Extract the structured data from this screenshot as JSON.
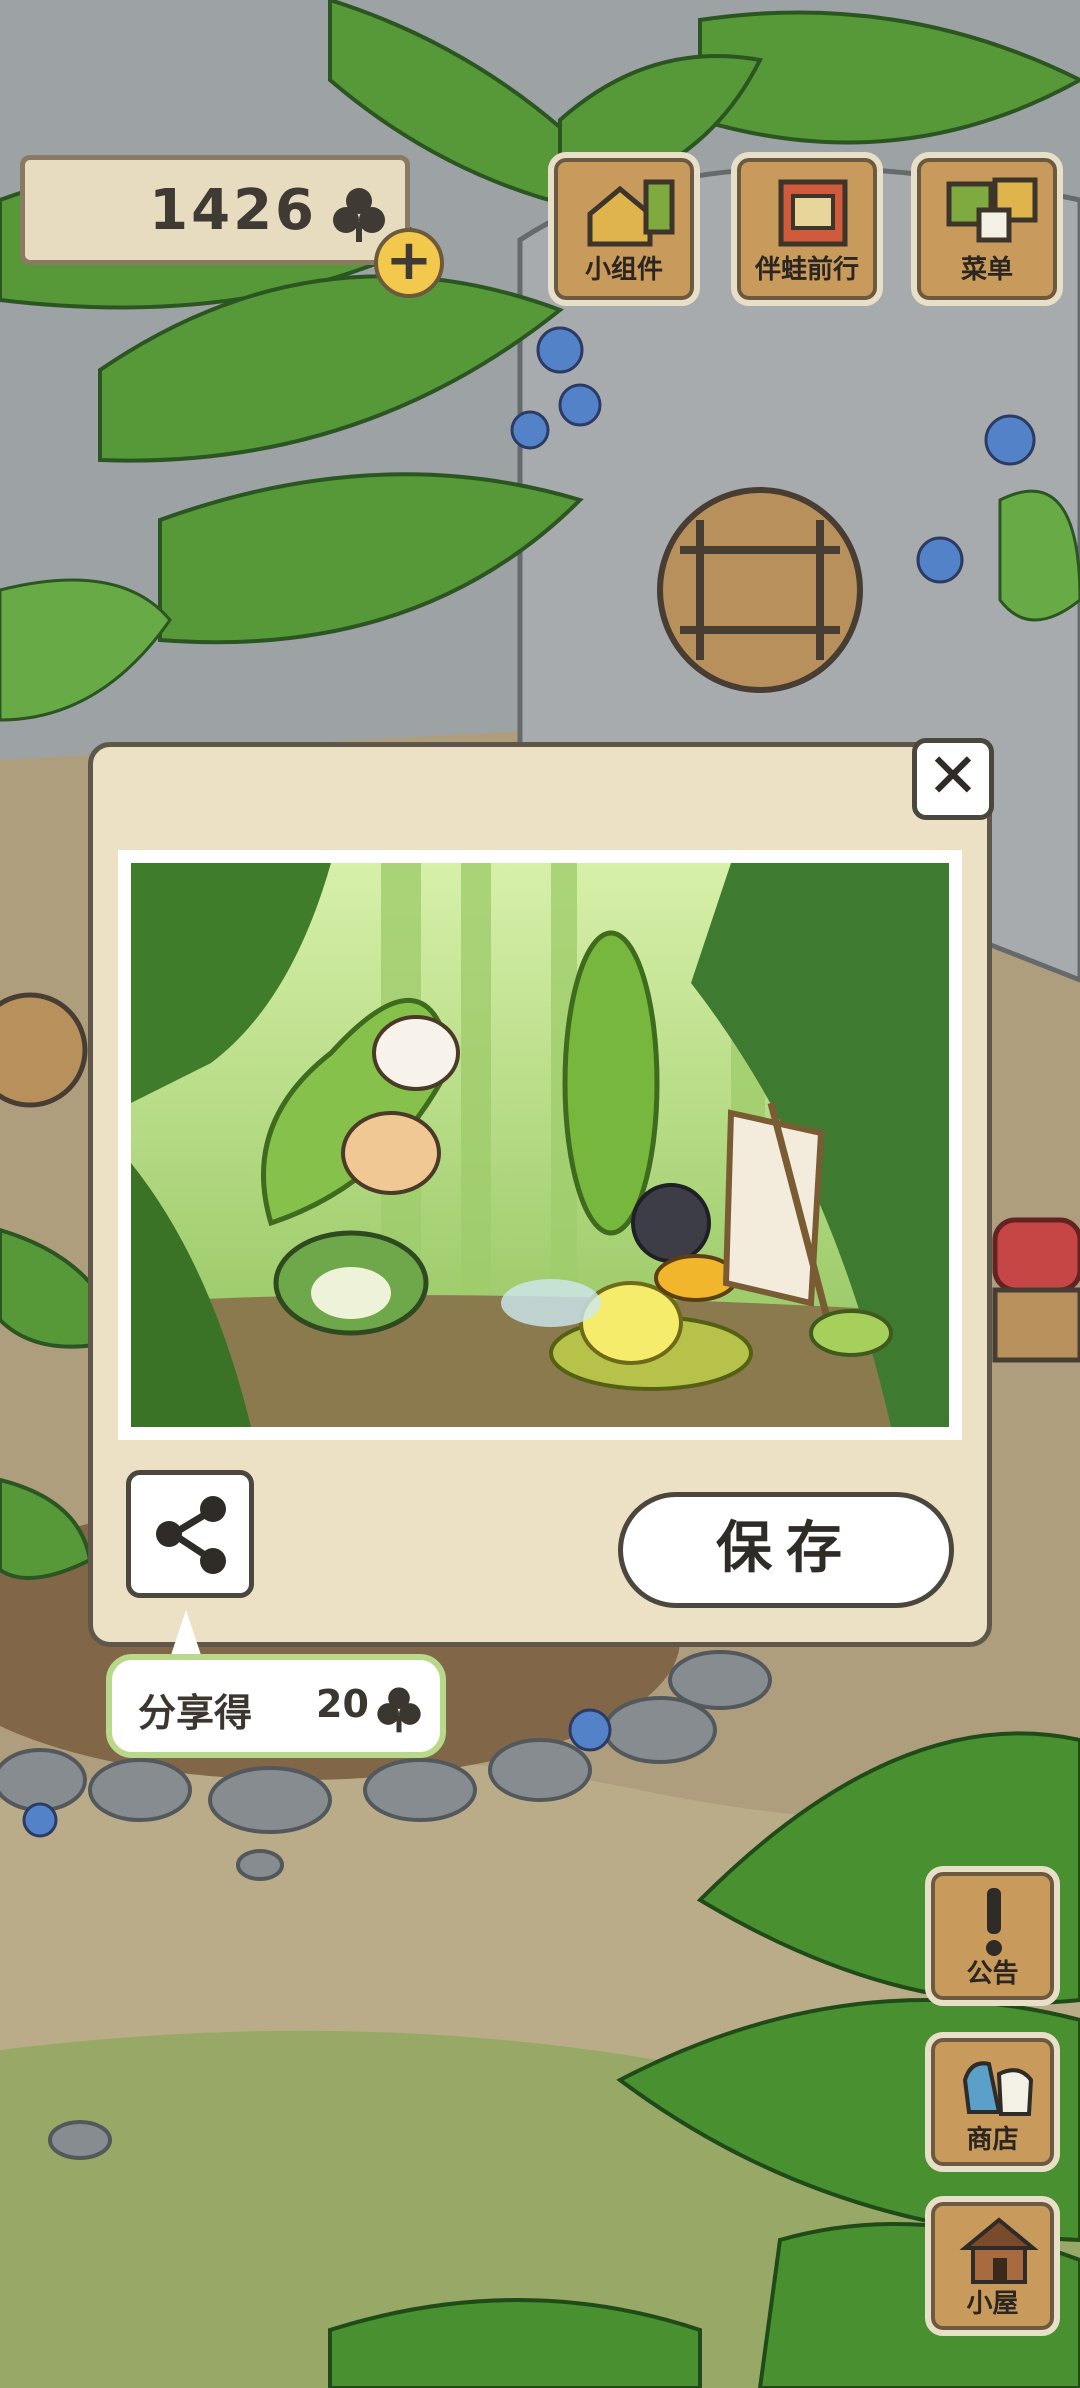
{
  "hud": {
    "clover_count": "1426",
    "clover_icon": "clover-icon",
    "add_icon": "plus-icon",
    "add_label": "+"
  },
  "top_menu": [
    {
      "label": "小组件",
      "icon": "widget-icon"
    },
    {
      "label": "伴蛙前行",
      "icon": "journal-icon"
    },
    {
      "label": "菜单",
      "icon": "menu-icon"
    }
  ],
  "side_menu": [
    {
      "label": "公告",
      "icon": "exclamation-icon"
    },
    {
      "label": "商店",
      "icon": "shop-bags-icon"
    },
    {
      "label": "小屋",
      "icon": "house-icon"
    }
  ],
  "dialog": {
    "close_label": "✕",
    "photo_description": "frog-photo",
    "share_icon": "share-icon",
    "save_label": "保存",
    "share_reward_text": "分享得",
    "share_reward_amount": "20",
    "reward_icon": "clover-icon"
  },
  "colors": {
    "panel": "#ece1c4",
    "panel_border": "#5f584a",
    "wood": "#c89a5c",
    "leaf": "#5da33d",
    "tooltip_border": "#b9d98a"
  }
}
